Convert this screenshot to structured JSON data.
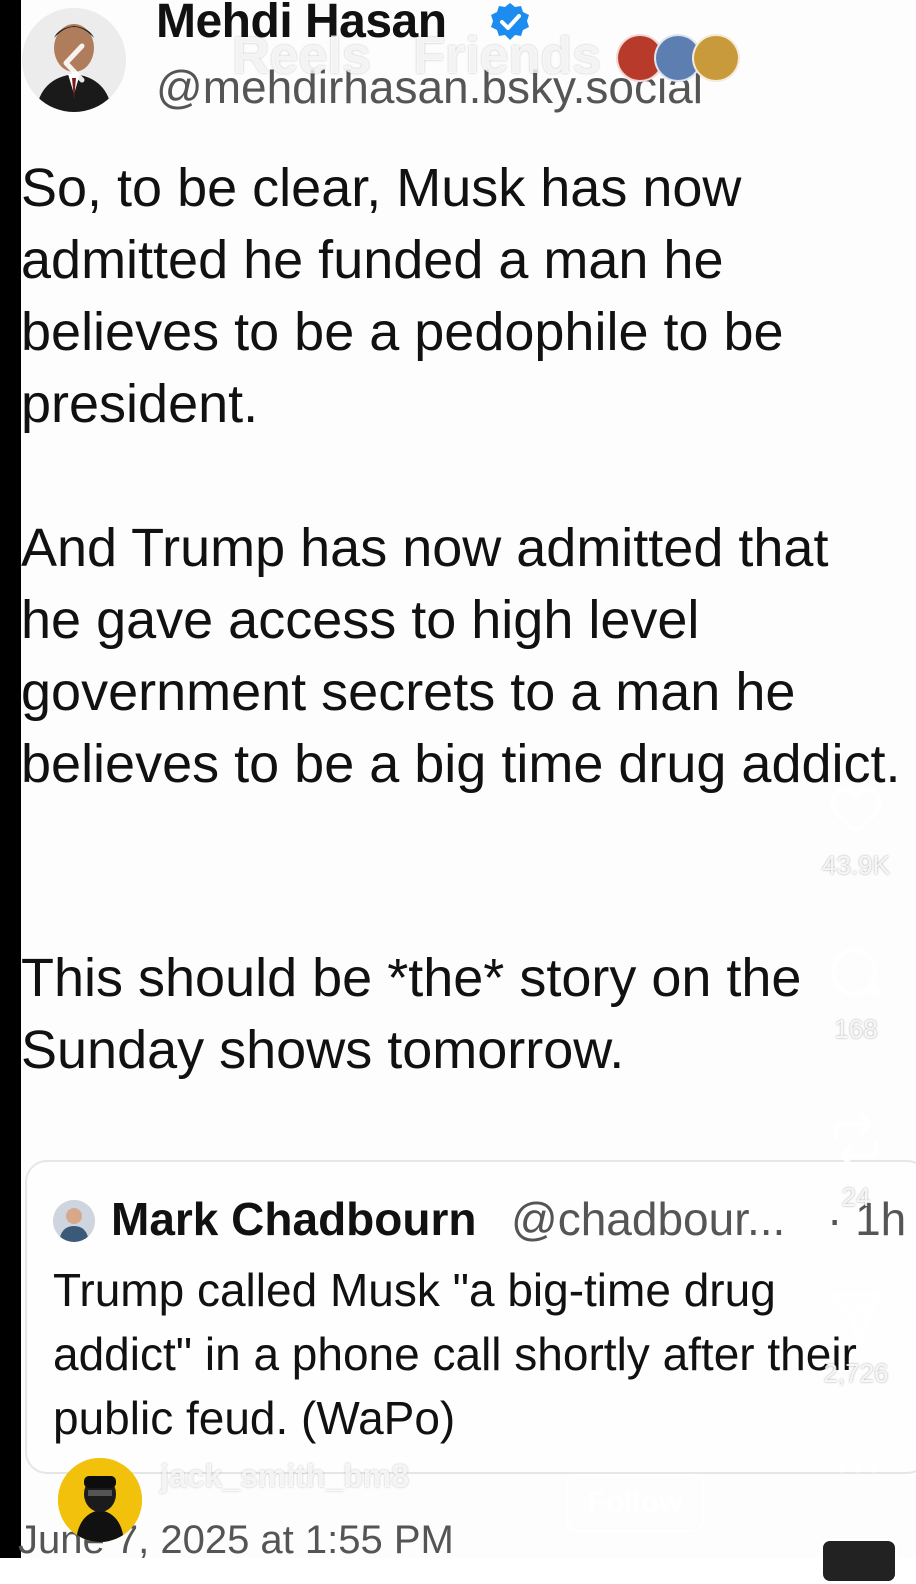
{
  "post": {
    "author_name": "Mehdi Hasan",
    "handle": "@mehdirhasan.bsky.social",
    "paragraphs": [
      "So, to be clear, Musk has now admitted he funded a man he believes to be a pedophile to be president.",
      "And Trump has now admitted that he gave access to high level government secrets to a man he believes to be a big time drug addict.",
      "This should be *the* story on the Sunday shows tomorrow."
    ],
    "date": "June 7, 2025 at 1:55 PM"
  },
  "quoted_post": {
    "author_name": "Mark Chadbourn",
    "handle": "@chadbour...",
    "time": "· 1h",
    "text": "Trump called Musk \"a big-time drug addict\" in a phone call shortly after their public feud. (WaPo)"
  },
  "reels_overlay": {
    "tabs": [
      "Reels",
      "Friends"
    ],
    "likes": "43.9K",
    "comments": "168",
    "reposts": "24",
    "shares": "2,726",
    "creator_name": "jack_smith_bm8",
    "follow_label": "Follow"
  },
  "icons": {
    "back": "chevron-left-icon",
    "verified": "verified-badge-icon",
    "like": "heart-icon",
    "comment": "comment-icon",
    "repost": "repost-icon",
    "share": "send-icon",
    "more": "more-icon"
  },
  "colors": {
    "verified": "#1d8cf0",
    "text": "#111111",
    "muted": "#555555",
    "overlay_text": "#ffffff"
  }
}
